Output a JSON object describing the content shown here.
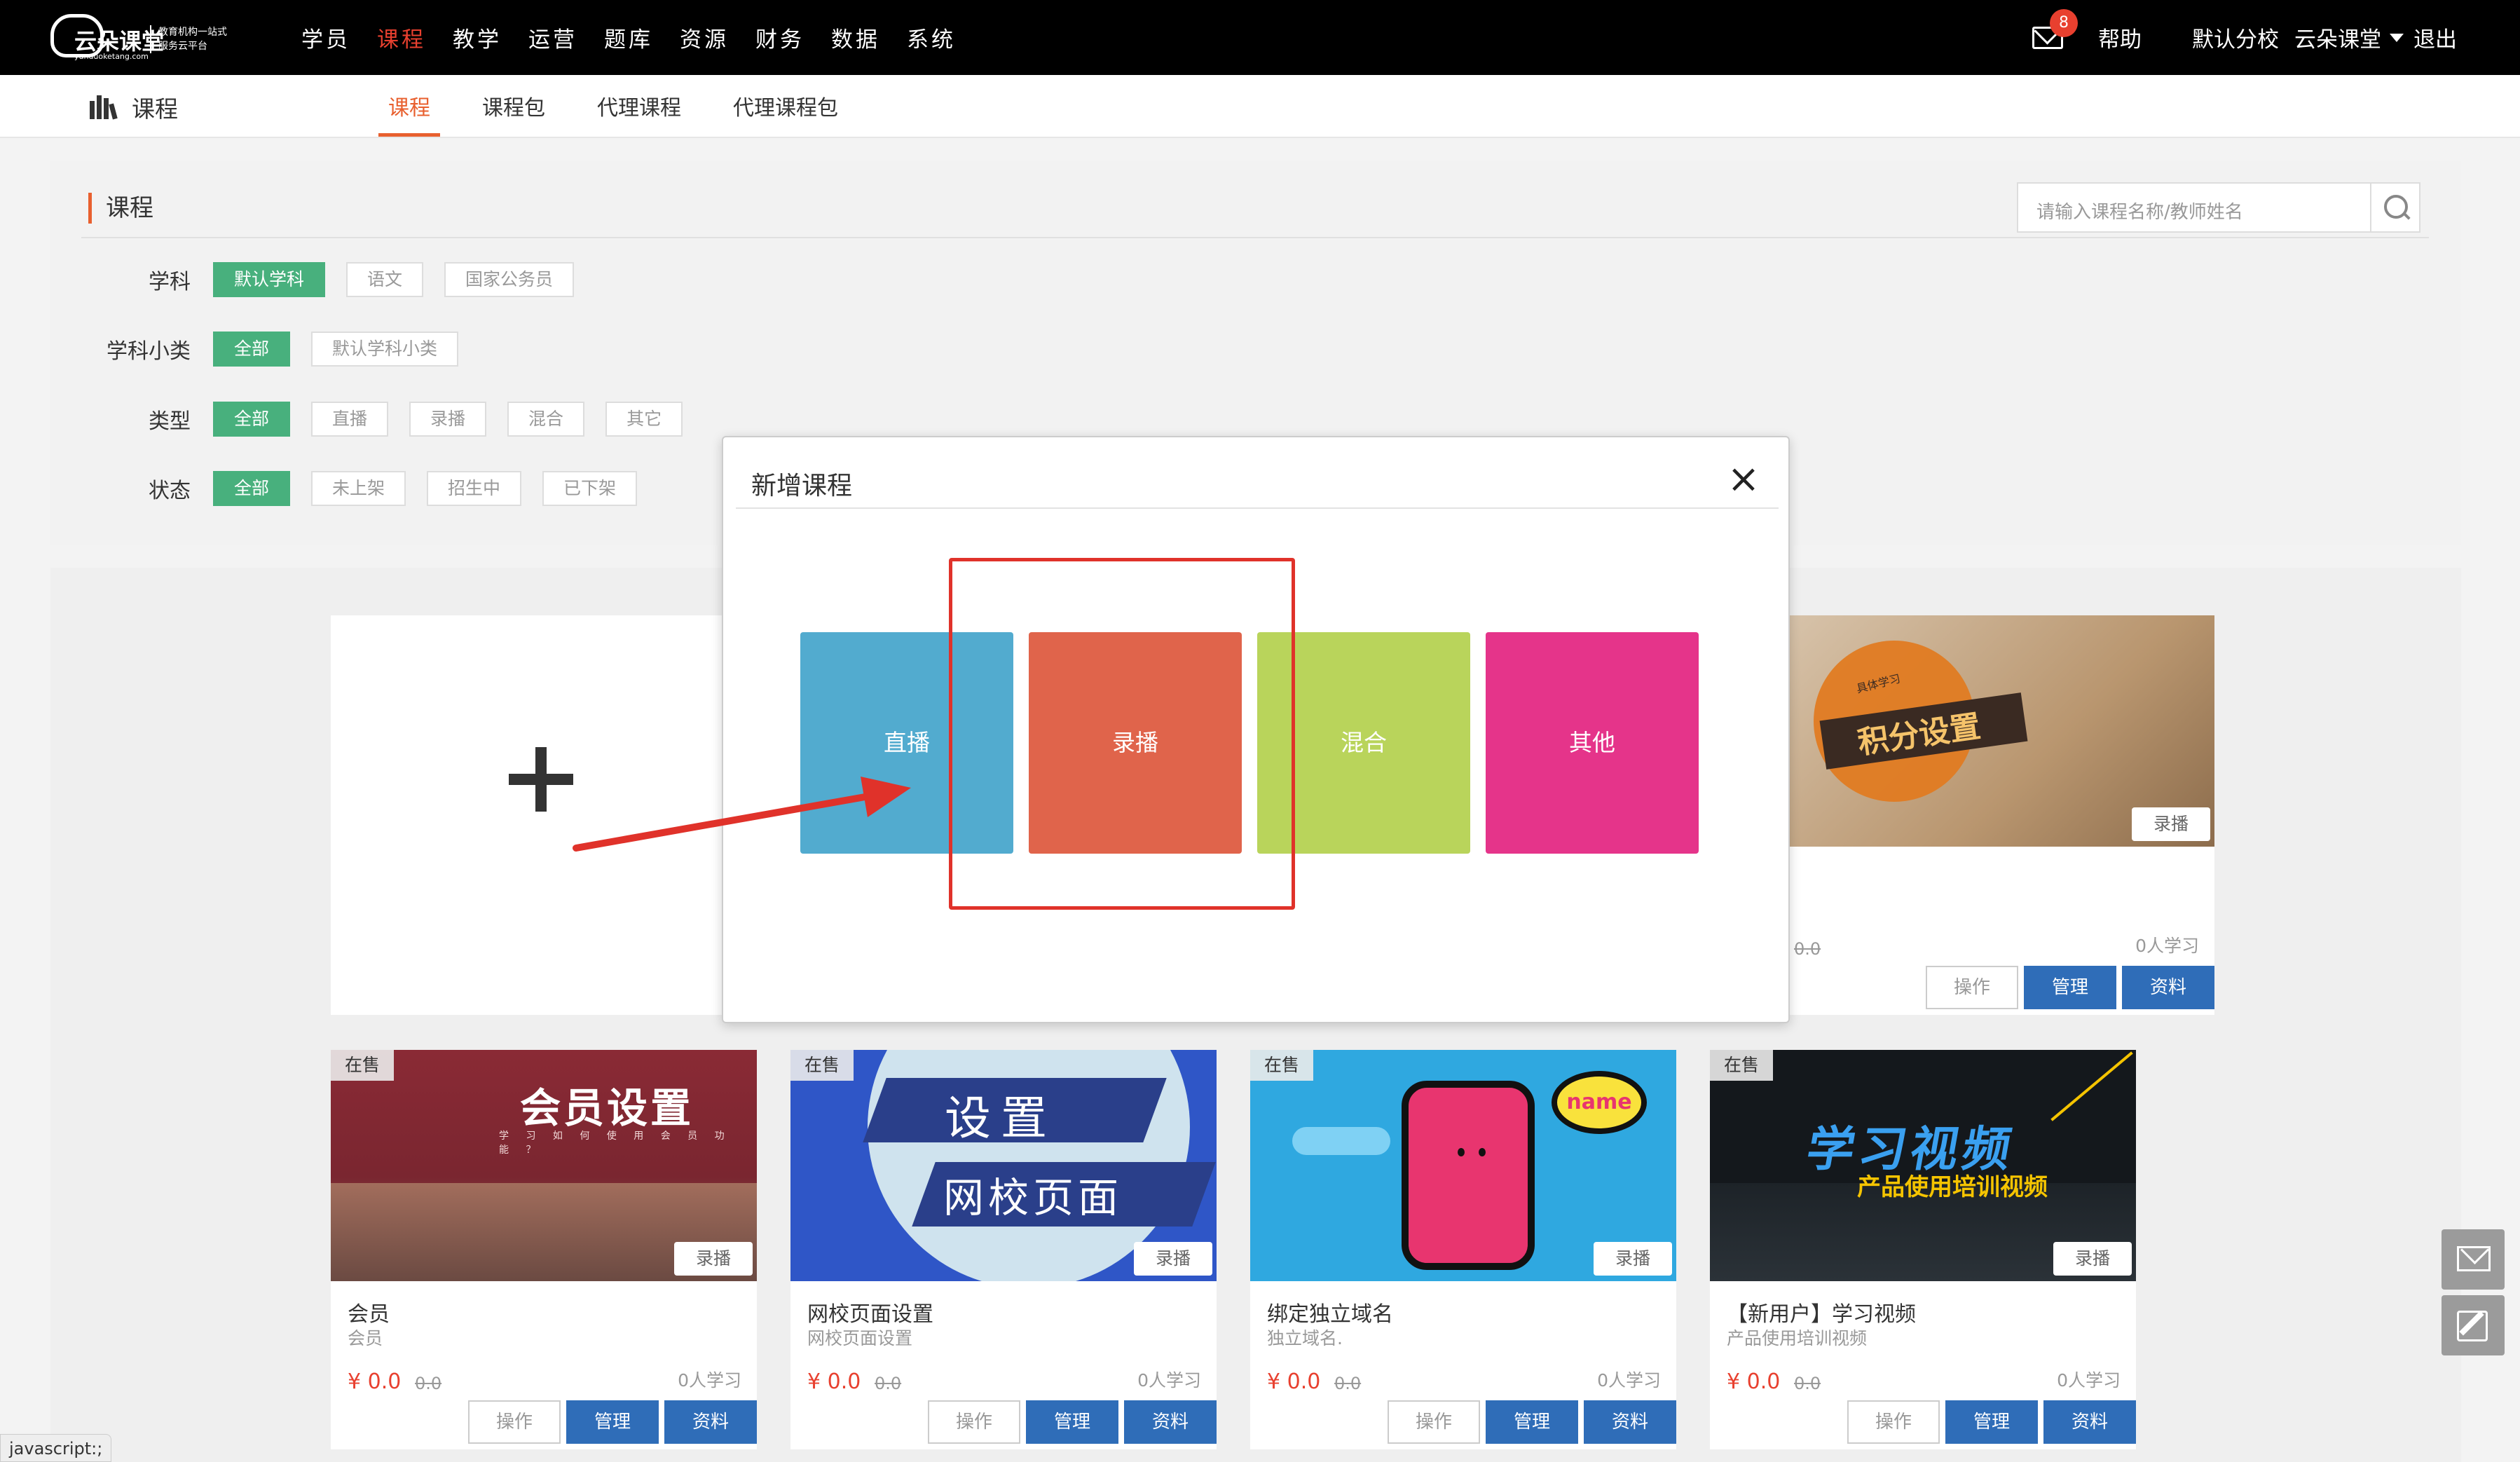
{
  "brand": {
    "name": "云朵课堂",
    "url": "yunduoketang.com",
    "slogan": "教育机构一站式服务云平台"
  },
  "topnav": {
    "items": [
      "学员",
      "课程",
      "教学",
      "运营",
      "题库",
      "资源",
      "财务",
      "数据",
      "系统"
    ],
    "active": "课程"
  },
  "topright": {
    "mail_count": "8",
    "help": "帮助",
    "branch": "默认分校",
    "user": "云朵课堂",
    "logout": "退出"
  },
  "subnav": {
    "section": "课程",
    "tabs": [
      "课程",
      "课程包",
      "代理课程",
      "代理课程包"
    ],
    "active": "课程"
  },
  "filter": {
    "title": "课程",
    "search_placeholder": "请输入课程名称/教师姓名",
    "rows": [
      {
        "label": "学科",
        "options": [
          "默认学科",
          "语文",
          "国家公务员"
        ],
        "selected": "默认学科"
      },
      {
        "label": "学科小类",
        "options": [
          "全部",
          "默认学科小类"
        ],
        "selected": "全部"
      },
      {
        "label": "类型",
        "options": [
          "全部",
          "直播",
          "录播",
          "混合",
          "其它"
        ],
        "selected": "全部"
      },
      {
        "label": "状态",
        "options": [
          "全部",
          "未上架",
          "招生中",
          "已下架"
        ],
        "selected": "全部"
      }
    ]
  },
  "courses": [
    {
      "sale": "在售",
      "title": "会员",
      "subtitle": "会员",
      "price": "¥ 0.0",
      "old_price": "0.0",
      "learners": "0人学习",
      "type": "录播",
      "art": {
        "big": "会员设置",
        "small": "学 习 如 何 使 用 会 员 功 能 ？"
      }
    },
    {
      "sale": "在售",
      "title": "网校页面设置",
      "subtitle": "网校页面设置",
      "price": "¥ 0.0",
      "old_price": "0.0",
      "learners": "0人学习",
      "type": "录播",
      "art": {
        "l1": "设置",
        "l2": "网校页面"
      }
    },
    {
      "sale": "在售",
      "title": "绑定独立域名",
      "subtitle": "独立域名.",
      "price": "¥ 0.0",
      "old_price": "0.0",
      "learners": "0人学习",
      "type": "录播",
      "art": {
        "bubble": "name"
      }
    },
    {
      "sale": "在售",
      "title": "【新用户】学习视频",
      "subtitle": "产品使用培训视频",
      "price": "¥ 0.0",
      "old_price": "0.0",
      "learners": "0人学习",
      "type": "录播",
      "art": {
        "l1": "学习视频",
        "l2": "产品使用培训视频"
      }
    }
  ],
  "top_right_card": {
    "type": "录播",
    "old_price": "0.0",
    "learners": "0人学习",
    "art": {
      "main": "积分设置",
      "small": "具体学习"
    }
  },
  "card_buttons": {
    "operate": "操作",
    "manage": "管理",
    "material": "资料"
  },
  "modal": {
    "title": "新增课程",
    "close": "×",
    "options": [
      "直播",
      "录播",
      "混合",
      "其他"
    ]
  },
  "status_bar": "javascript:;"
}
